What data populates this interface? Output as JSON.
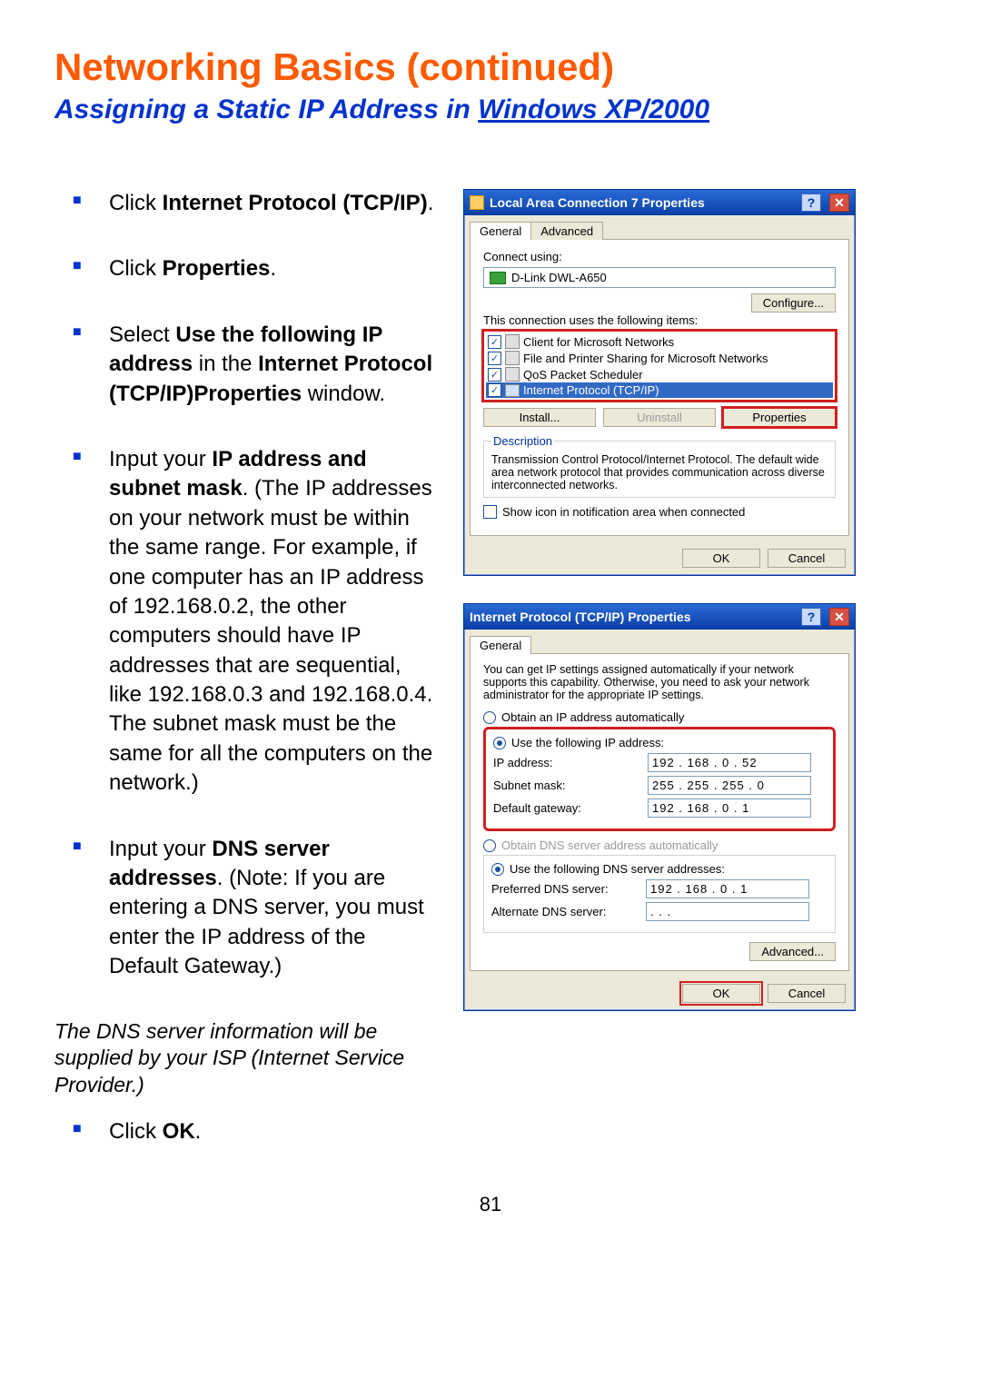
{
  "header": {
    "title": "Networking Basics  (continued)",
    "subtitle_a": "Assigning a Static IP Address in ",
    "subtitle_b": "Windows XP/2000"
  },
  "steps": {
    "s1a": "Click ",
    "s1b": "Internet Protocol (TCP/IP)",
    "s1c": ".",
    "s2a": "Click ",
    "s2b": " Properties",
    "s2c": ".",
    "s3a": "Select ",
    "s3b": "Use the following IP address",
    "s3c": " in the ",
    "s3d": "Internet Protocol (TCP/IP)Properties",
    "s3e": " window.",
    "s4a": "Input your ",
    "s4b": "IP address and subnet mask",
    "s4c": ". (The IP addresses on your network must be within the same range. For example, if one computer has an IP address of 192.168.0.2, the other computers should have IP addresses that are sequential, like 192.168.0.3 and 192.168.0.4. The subnet mask must be the same for all the computers on the network.)",
    "s5a": "Input your ",
    "s5b": "DNS server addresses",
    "s5c": ". (Note: If you are entering a DNS server, you must enter the IP address of the Default Gateway.)",
    "s6a": "Click ",
    "s6b": "OK",
    "s6c": "."
  },
  "dns_note": "The DNS server information will be supplied by your ISP (Internet Service Provider.)",
  "page_number": "81",
  "dlg1": {
    "title": "Local Area Connection 7 Properties",
    "tab_general": "General",
    "tab_advanced": "Advanced",
    "connect_using": "Connect using:",
    "adapter": "D-Link DWL-A650",
    "configure": "Configure...",
    "uses_items": "This connection uses the following items:",
    "items": [
      "Client for Microsoft Networks",
      "File and Printer Sharing for Microsoft Networks",
      "QoS Packet Scheduler",
      "Internet Protocol (TCP/IP)"
    ],
    "install": "Install...",
    "uninstall": "Uninstall",
    "properties": "Properties",
    "desc_label": "Description",
    "desc_text": "Transmission Control Protocol/Internet Protocol. The default wide area network protocol that provides communication across diverse interconnected networks.",
    "show_icon": "Show icon in notification area when connected",
    "ok": "OK",
    "cancel": "Cancel"
  },
  "dlg2": {
    "title": "Internet Protocol (TCP/IP) Properties",
    "tab_general": "General",
    "info": "You can get IP settings assigned automatically if your network supports this capability. Otherwise, you need to ask your network administrator for the appropriate IP settings.",
    "obtain_ip": "Obtain an IP address automatically",
    "use_ip": "Use the following IP address:",
    "ip_label": "IP address:",
    "ip_value": "192 . 168 .   0  .  52",
    "subnet_label": "Subnet mask:",
    "subnet_value": "255 . 255 . 255 .   0",
    "gw_label": "Default gateway:",
    "gw_value": "192 . 168 .   0  .   1",
    "obtain_dns": "Obtain DNS server address automatically",
    "use_dns": "Use the following DNS server addresses:",
    "pref_dns_label": "Preferred DNS server:",
    "pref_dns_value": "192 . 168 .   0  .   1",
    "alt_dns_label": "Alternate DNS server:",
    "alt_dns_value": "  .        .        .   ",
    "advanced": "Advanced...",
    "ok": "OK",
    "cancel": "Cancel"
  }
}
